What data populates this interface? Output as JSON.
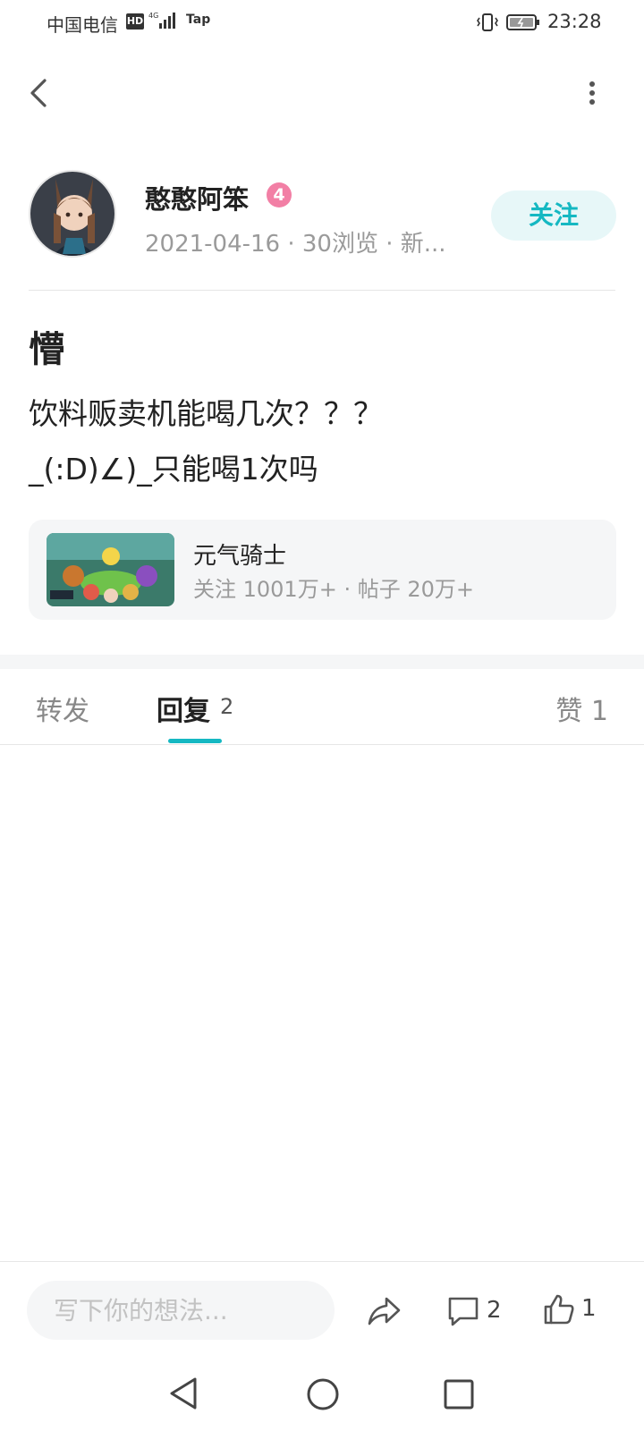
{
  "status_bar": {
    "carrier": "中国电信",
    "hd": "HD",
    "network": "4G",
    "app_tag": "Tap",
    "time": "23:28"
  },
  "author": {
    "name": "憨憨阿笨",
    "level": "4",
    "meta": "2021-04-16 · 30浏览 · 新...",
    "follow_label": "关注"
  },
  "post": {
    "title": "懵",
    "body_lines": [
      "饮料贩卖机能喝几次？？？",
      "_(:D)∠)_只能喝1次吗"
    ]
  },
  "game": {
    "name": "元气骑士",
    "stats": "关注 1001万+ · 帖子 20万+"
  },
  "tabs": {
    "repost": "转发",
    "reply": "回复",
    "reply_count": "2",
    "like": "赞 1"
  },
  "bottom_bar": {
    "input_placeholder": "写下你的想法...",
    "comment_count": "2",
    "like_count": "1"
  },
  "colors": {
    "accent": "#15b8c2",
    "follow_bg": "#e7f7f8",
    "level_badge": "#f27fa5",
    "card_bg": "#f5f6f7"
  },
  "icons": [
    "back-icon",
    "more-icon",
    "share-icon",
    "comment-icon",
    "like-icon",
    "nav-back-icon",
    "nav-home-icon",
    "nav-recent-icon",
    "vibrate-icon",
    "battery-icon",
    "signal-icon"
  ]
}
